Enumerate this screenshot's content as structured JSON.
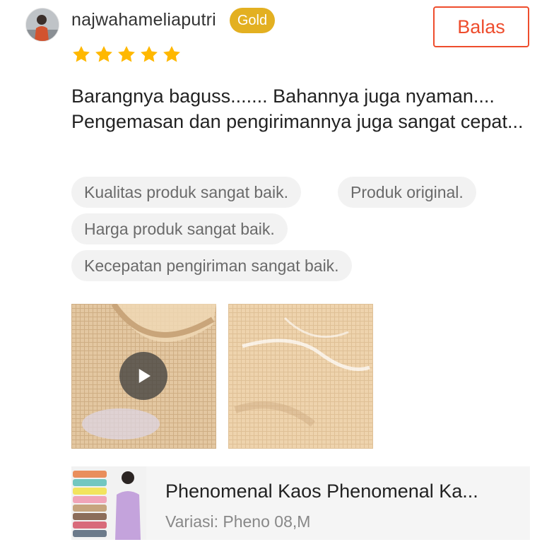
{
  "review": {
    "username": "najwahameliaputri",
    "badge": "Gold",
    "reply_label": "Balas",
    "rating": 5,
    "rating_max": 5,
    "text": "Barangnya baguss....... Bahannya juga nyaman.... Pengemasan dan pengirimannya juga sangat cepat...",
    "tags": [
      "Kualitas produk sangat baik.",
      "Produk original.",
      "Harga produk sangat baik.",
      "Kecepatan pengiriman sangat baik."
    ],
    "media": [
      {
        "type": "video",
        "icon": "play-icon"
      },
      {
        "type": "photo"
      }
    ]
  },
  "product": {
    "title": "Phenomenal Kaos Phenomenal Ka...",
    "variant": "Variasi: Pheno 08,M"
  },
  "colors": {
    "accent": "#ee4d2d",
    "star": "#ffb800",
    "badge": "#e3b021",
    "tag_bg": "#f2f2f2"
  }
}
